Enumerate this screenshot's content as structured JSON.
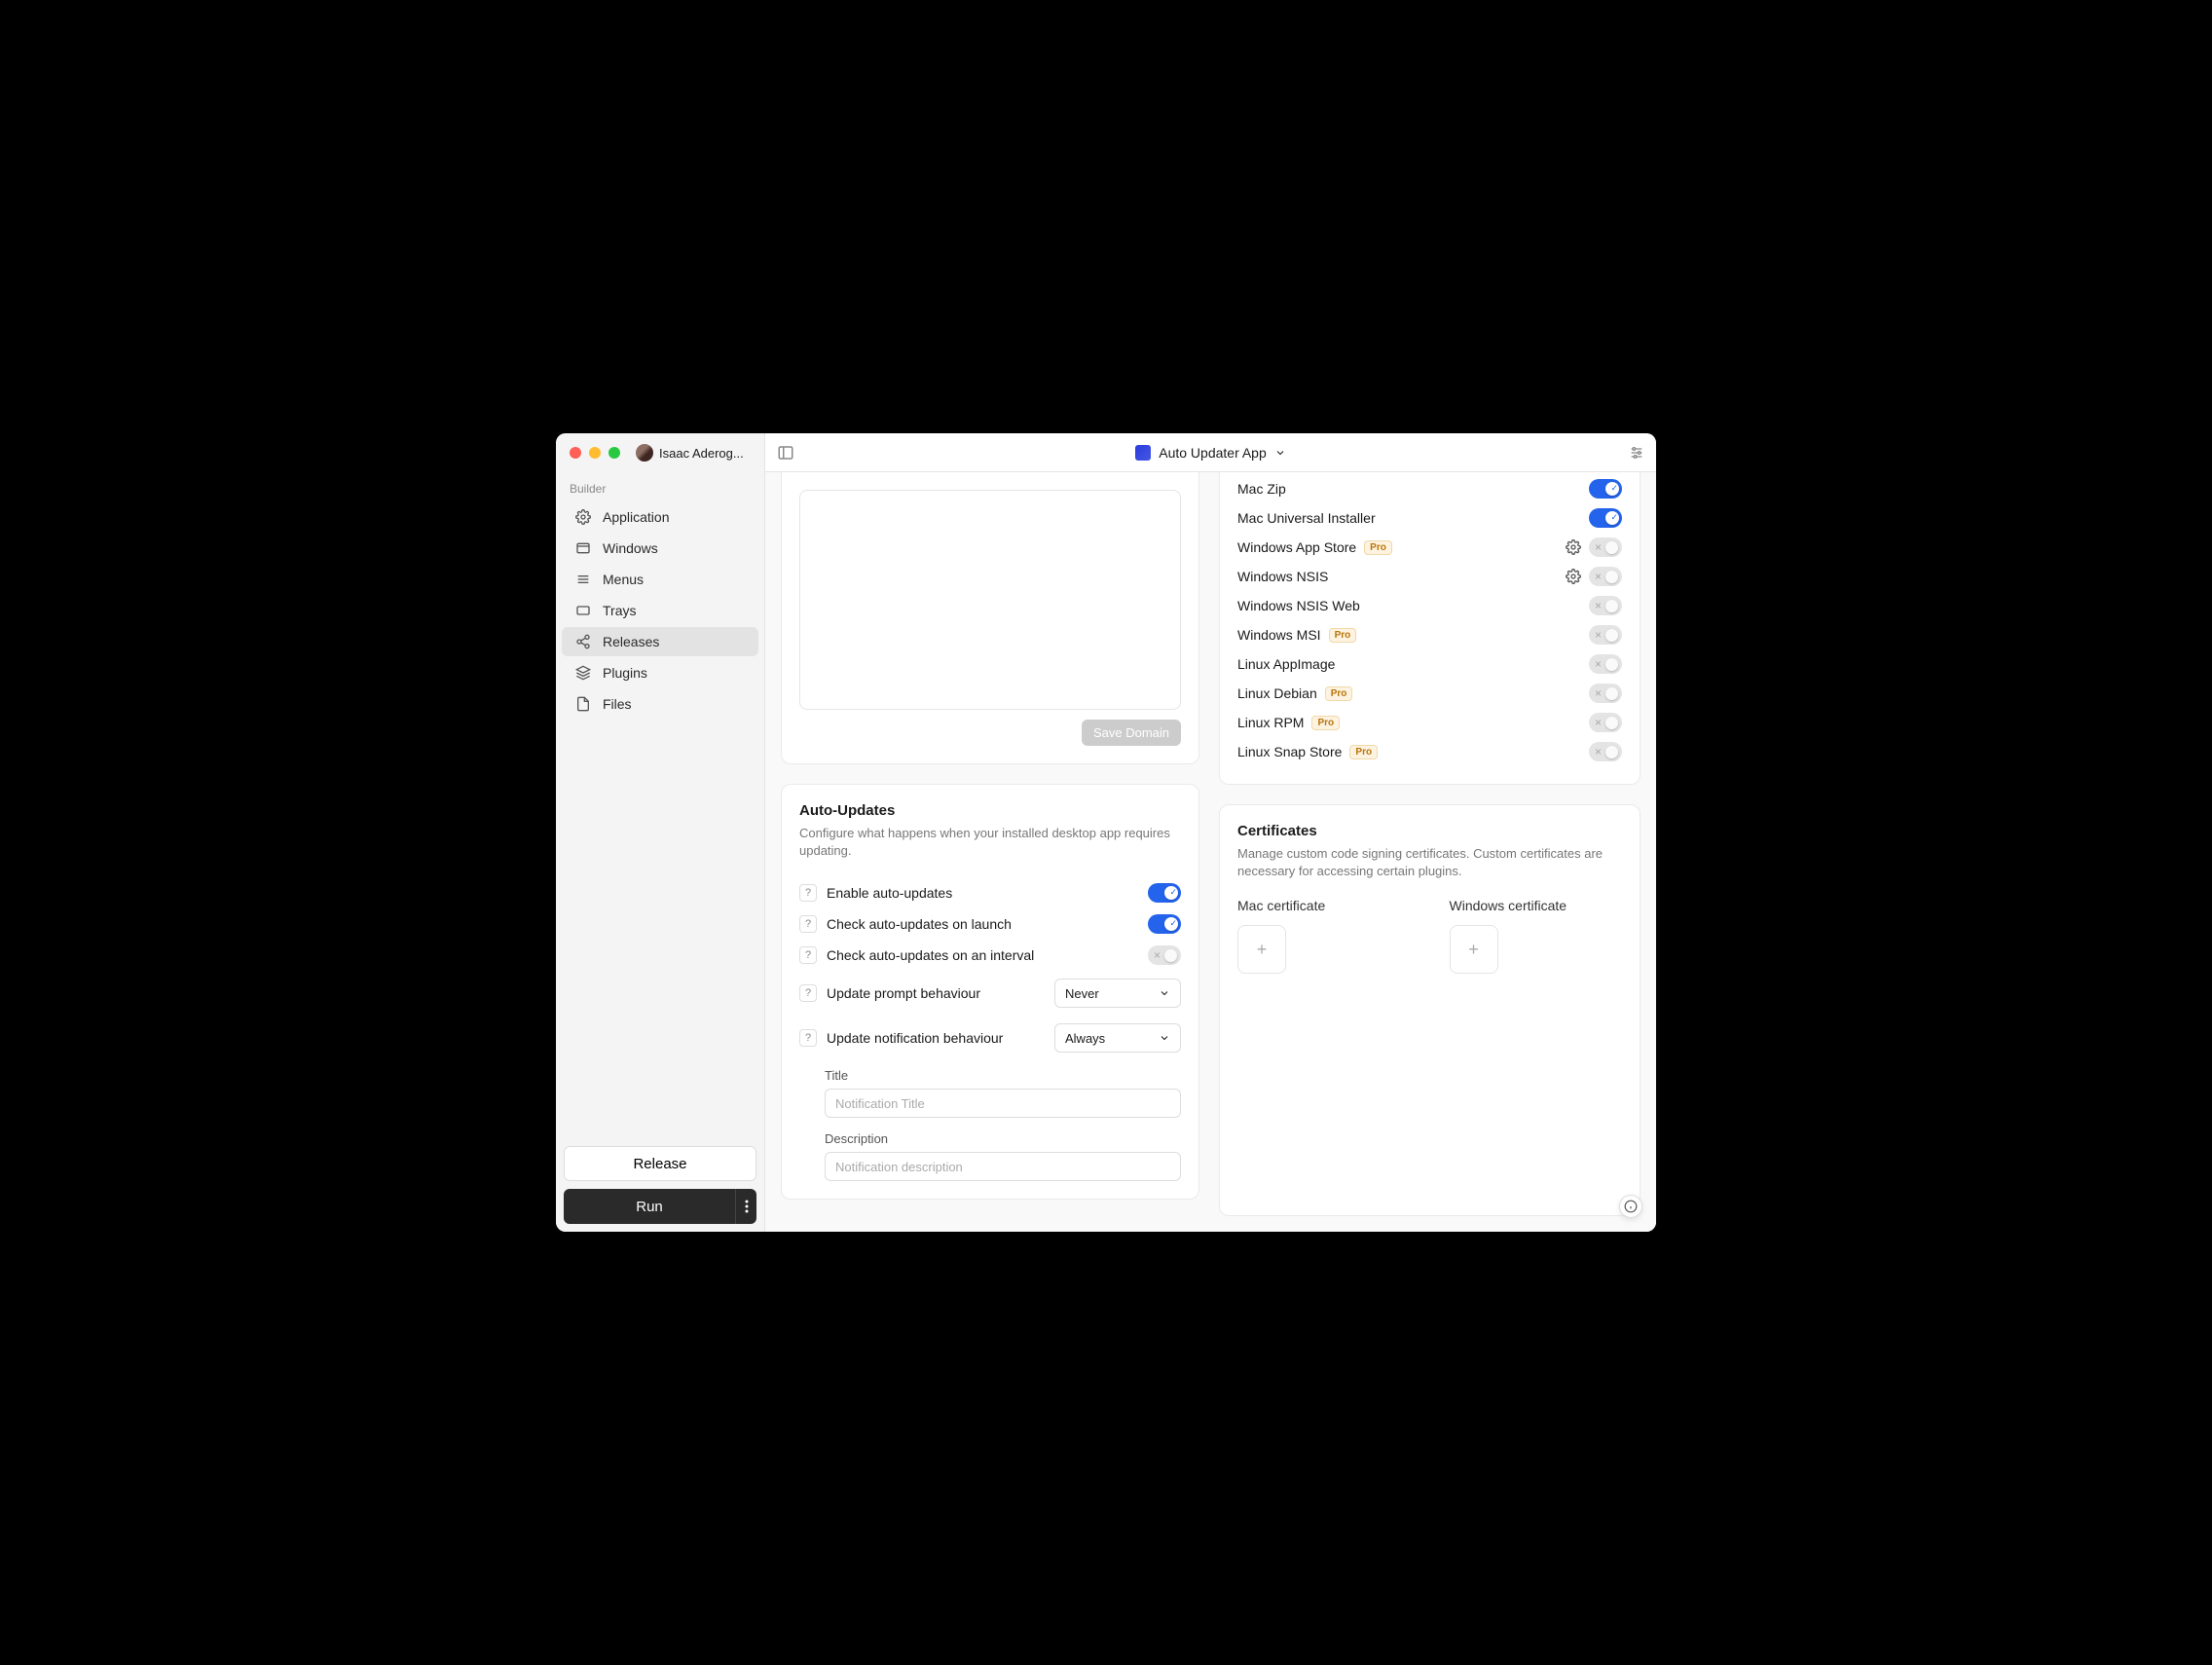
{
  "user": {
    "name": "Isaac Aderog..."
  },
  "app": {
    "title": "Auto Updater App"
  },
  "sidebar": {
    "section": "Builder",
    "items": [
      {
        "label": "Application"
      },
      {
        "label": "Windows"
      },
      {
        "label": "Menus"
      },
      {
        "label": "Trays"
      },
      {
        "label": "Releases"
      },
      {
        "label": "Plugins"
      },
      {
        "label": "Files"
      }
    ],
    "release_button": "Release",
    "run_button": "Run"
  },
  "domain": {
    "save_button": "Save Domain"
  },
  "targets": [
    {
      "name": "Mac Zip",
      "pro": false,
      "gear": false,
      "on": true
    },
    {
      "name": "Mac Universal Installer",
      "pro": false,
      "gear": false,
      "on": true
    },
    {
      "name": "Windows App Store",
      "pro": true,
      "gear": true,
      "on": false
    },
    {
      "name": "Windows NSIS",
      "pro": false,
      "gear": true,
      "on": false
    },
    {
      "name": "Windows NSIS Web",
      "pro": false,
      "gear": false,
      "on": false
    },
    {
      "name": "Windows MSI",
      "pro": true,
      "gear": false,
      "on": false
    },
    {
      "name": "Linux AppImage",
      "pro": false,
      "gear": false,
      "on": false
    },
    {
      "name": "Linux Debian",
      "pro": true,
      "gear": false,
      "on": false
    },
    {
      "name": "Linux RPM",
      "pro": true,
      "gear": false,
      "on": false
    },
    {
      "name": "Linux Snap Store",
      "pro": true,
      "gear": false,
      "on": false
    }
  ],
  "pro_label": "Pro",
  "auto_updates": {
    "title": "Auto-Updates",
    "desc": "Configure what happens when your installed desktop app requires updating.",
    "enable_label": "Enable auto-updates",
    "enable_on": true,
    "check_launch_label": "Check auto-updates on launch",
    "check_launch_on": true,
    "check_interval_label": "Check auto-updates on an interval",
    "check_interval_on": false,
    "prompt_label": "Update prompt behaviour",
    "prompt_value": "Never",
    "notif_label": "Update notification behaviour",
    "notif_value": "Always",
    "title_field_label": "Title",
    "title_placeholder": "Notification Title",
    "desc_field_label": "Description",
    "desc_placeholder": "Notification description"
  },
  "certificates": {
    "title": "Certificates",
    "desc": "Manage custom code signing certificates. Custom certificates are necessary for accessing certain plugins.",
    "mac_label": "Mac certificate",
    "win_label": "Windows certificate"
  }
}
